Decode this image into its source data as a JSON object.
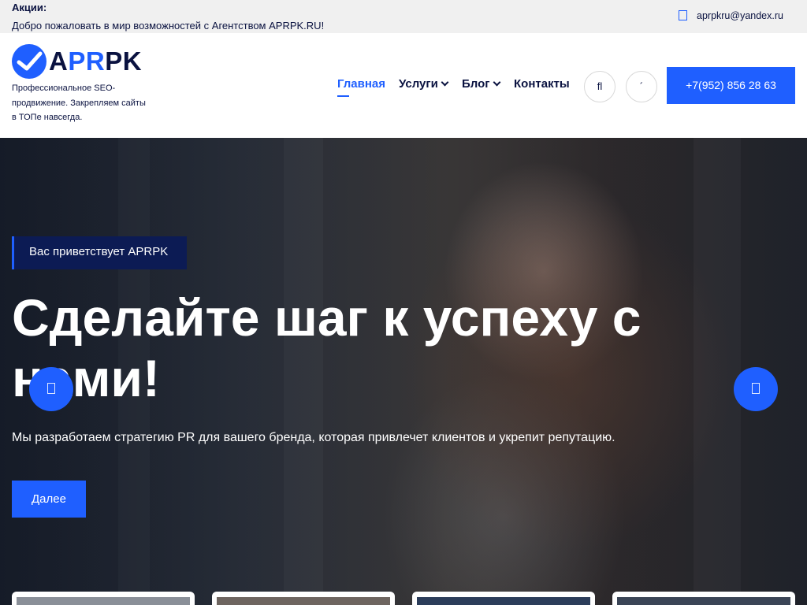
{
  "topbar": {
    "promo_label": "Акции:",
    "promo_text": "Добро пожаловать в мир возможностей с Агентством APRPK.RU!",
    "email": "aprpkru@yandex.ru"
  },
  "header": {
    "logo": {
      "seg_a": "A",
      "seg_b": "PR",
      "seg_c": "PK"
    },
    "tagline": "Профессиональное SEO-продвижение. Закрепляем сайты в ТОПе навсегда.",
    "nav": [
      {
        "label": "Главная",
        "active": true
      },
      {
        "label": "Услуги",
        "dropdown": true
      },
      {
        "label": "Блог",
        "dropdown": true
      },
      {
        "label": "Контакты"
      }
    ],
    "search_glyph": "fl",
    "account_glyph": "´",
    "phone": "+7(952) 856 28 63"
  },
  "hero": {
    "badge": "Вас приветствует APRPK",
    "title": "Сделайте шаг к успеху с нами!",
    "subtitle": "Мы разработаем стратегию PR для вашего бренда, которая привлечет клиентов и укрепит репутацию.",
    "cta": "Далее"
  },
  "colors": {
    "accent": "#1f5fff",
    "navy": "#0a1240",
    "badge_bg": "#0c1b54",
    "topbar_bg": "#f0f0f0"
  },
  "icons": {
    "mail": "mail-icon",
    "search": "search-icon",
    "account": "account-icon",
    "prev": "arrow-left-icon",
    "next": "arrow-right-icon"
  }
}
